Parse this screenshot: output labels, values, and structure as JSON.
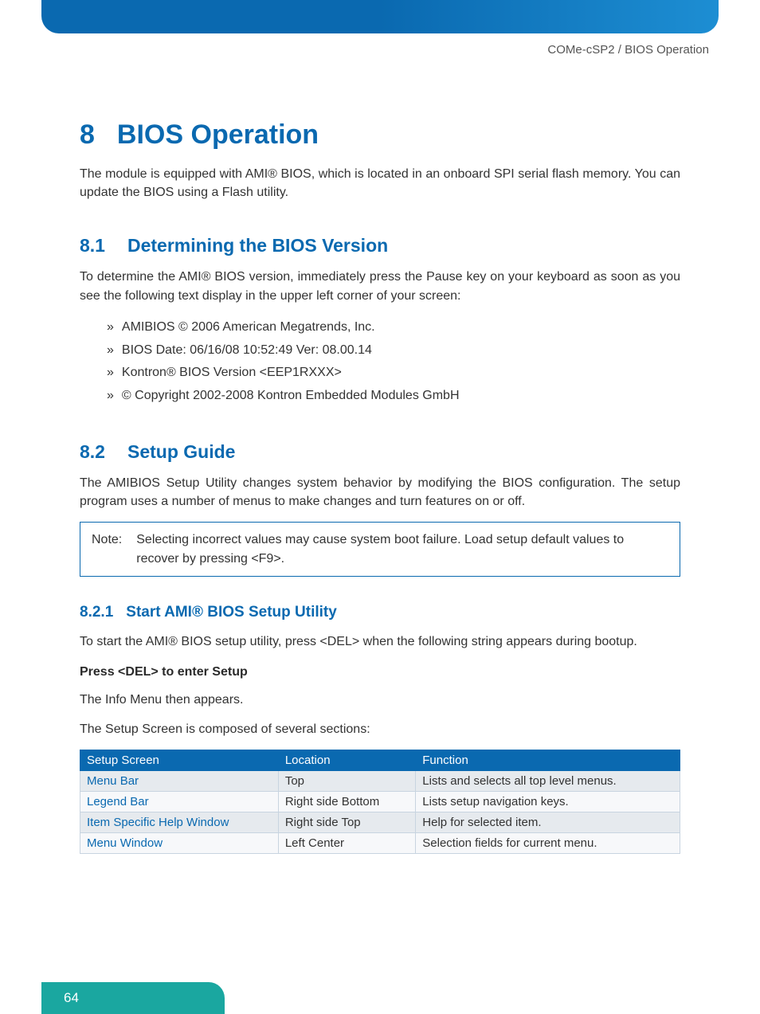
{
  "header": {
    "breadcrumb": "COMe-cSP2 / BIOS Operation"
  },
  "chapter": {
    "number": "8",
    "title": "BIOS Operation",
    "intro": "The module is equipped with AMI® BIOS, which is located in an onboard SPI serial flash memory. You can update the BIOS using a Flash utility."
  },
  "section1": {
    "number": "8.1",
    "title": "Determining the BIOS Version",
    "intro": "To determine the AMI® BIOS version, immediately press the Pause key on your keyboard as soon as you see the following text display in the upper left corner of your screen:",
    "items": [
      "AMIBIOS © 2006 American Megatrends, Inc.",
      "BIOS Date: 06/16/08 10:52:49 Ver: 08.00.14",
      "Kontron® BIOS Version <EEP1RXXX>",
      "© Copyright 2002-2008 Kontron Embedded Modules GmbH"
    ]
  },
  "section2": {
    "number": "8.2",
    "title": "Setup Guide",
    "intro": "The AMIBIOS Setup Utility changes system behavior by modifying the BIOS configuration. The setup program uses a number of menus to make changes and turn features on or off.",
    "note_label": "Note:",
    "note_text": "Selecting incorrect values may cause system boot failure. Load setup default values to recover by pressing <F9>."
  },
  "subsection": {
    "number": "8.2.1",
    "title": "Start AMI® BIOS Setup Utility",
    "p1": "To start the AMI® BIOS setup utility, press <DEL> when the following string appears during bootup.",
    "instr": "Press <DEL> to enter Setup",
    "p2": "The Info Menu then appears.",
    "p3": "The Setup Screen is composed of several sections:"
  },
  "table": {
    "headers": [
      "Setup Screen",
      "Location",
      "Function"
    ],
    "rows": [
      [
        "Menu Bar",
        "Top",
        "Lists and selects all top level menus."
      ],
      [
        "Legend Bar",
        "Right side Bottom",
        "Lists setup navigation keys."
      ],
      [
        "Item Specific Help Window",
        "Right side Top",
        "Help for selected item."
      ],
      [
        "Menu Window",
        "Left Center",
        "Selection fields for current menu."
      ]
    ]
  },
  "footer": {
    "page": "64"
  }
}
